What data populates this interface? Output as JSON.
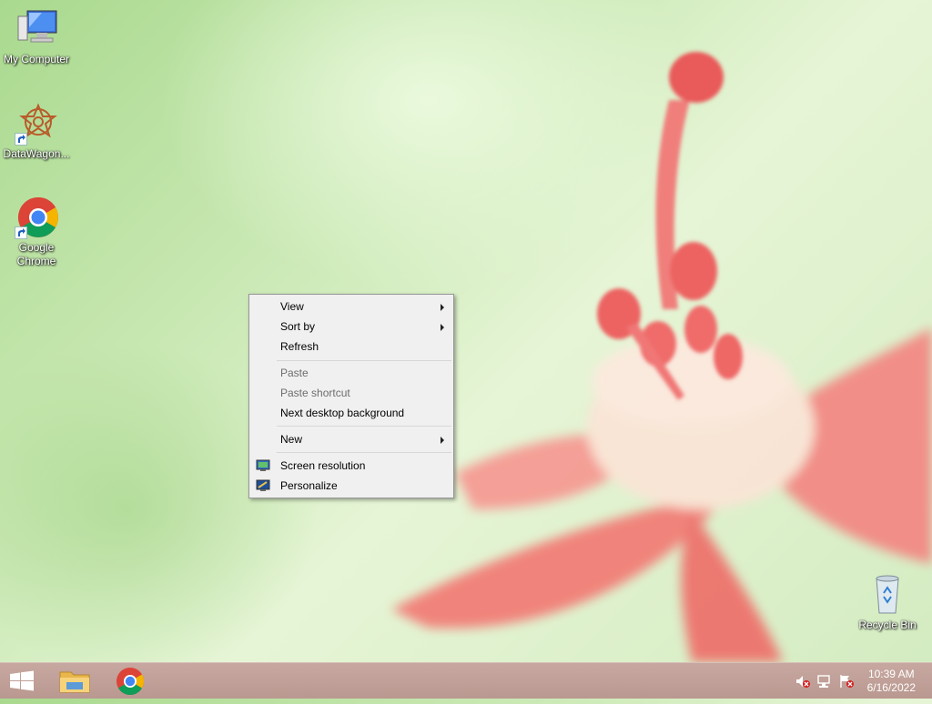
{
  "desktop": {
    "icons": [
      {
        "label": "My Computer",
        "icon": "computer-icon"
      },
      {
        "label": "DataWagon...",
        "icon": "datawagon-icon"
      },
      {
        "label": "Google Chrome",
        "icon": "chrome-icon"
      },
      {
        "label": "Recycle Bin",
        "icon": "recycle-bin-icon"
      }
    ]
  },
  "context_menu": {
    "items": [
      {
        "label": "View",
        "enabled": true,
        "submenu": true
      },
      {
        "label": "Sort by",
        "enabled": true,
        "submenu": true
      },
      {
        "label": "Refresh",
        "enabled": true
      },
      {
        "label": "Paste",
        "enabled": false
      },
      {
        "label": "Paste shortcut",
        "enabled": false
      },
      {
        "label": "Next desktop background",
        "enabled": true
      },
      {
        "label": "New",
        "enabled": true,
        "submenu": true
      },
      {
        "label": "Screen resolution",
        "enabled": true,
        "icon": "display-icon"
      },
      {
        "label": "Personalize",
        "enabled": true,
        "icon": "personalize-icon"
      }
    ]
  },
  "taskbar": {
    "pinned": [
      "windows-start-icon",
      "file-explorer-icon",
      "chrome-icon"
    ],
    "tray_icons": [
      "volume-muted-icon",
      "network-icon",
      "action-center-flag-icon"
    ],
    "clock": {
      "time": "10:39 AM",
      "date": "6/16/2022"
    }
  },
  "colors": {
    "taskbar": "#bf9f97",
    "menu_bg": "#f0f0f0",
    "flower": "#f07a78"
  }
}
